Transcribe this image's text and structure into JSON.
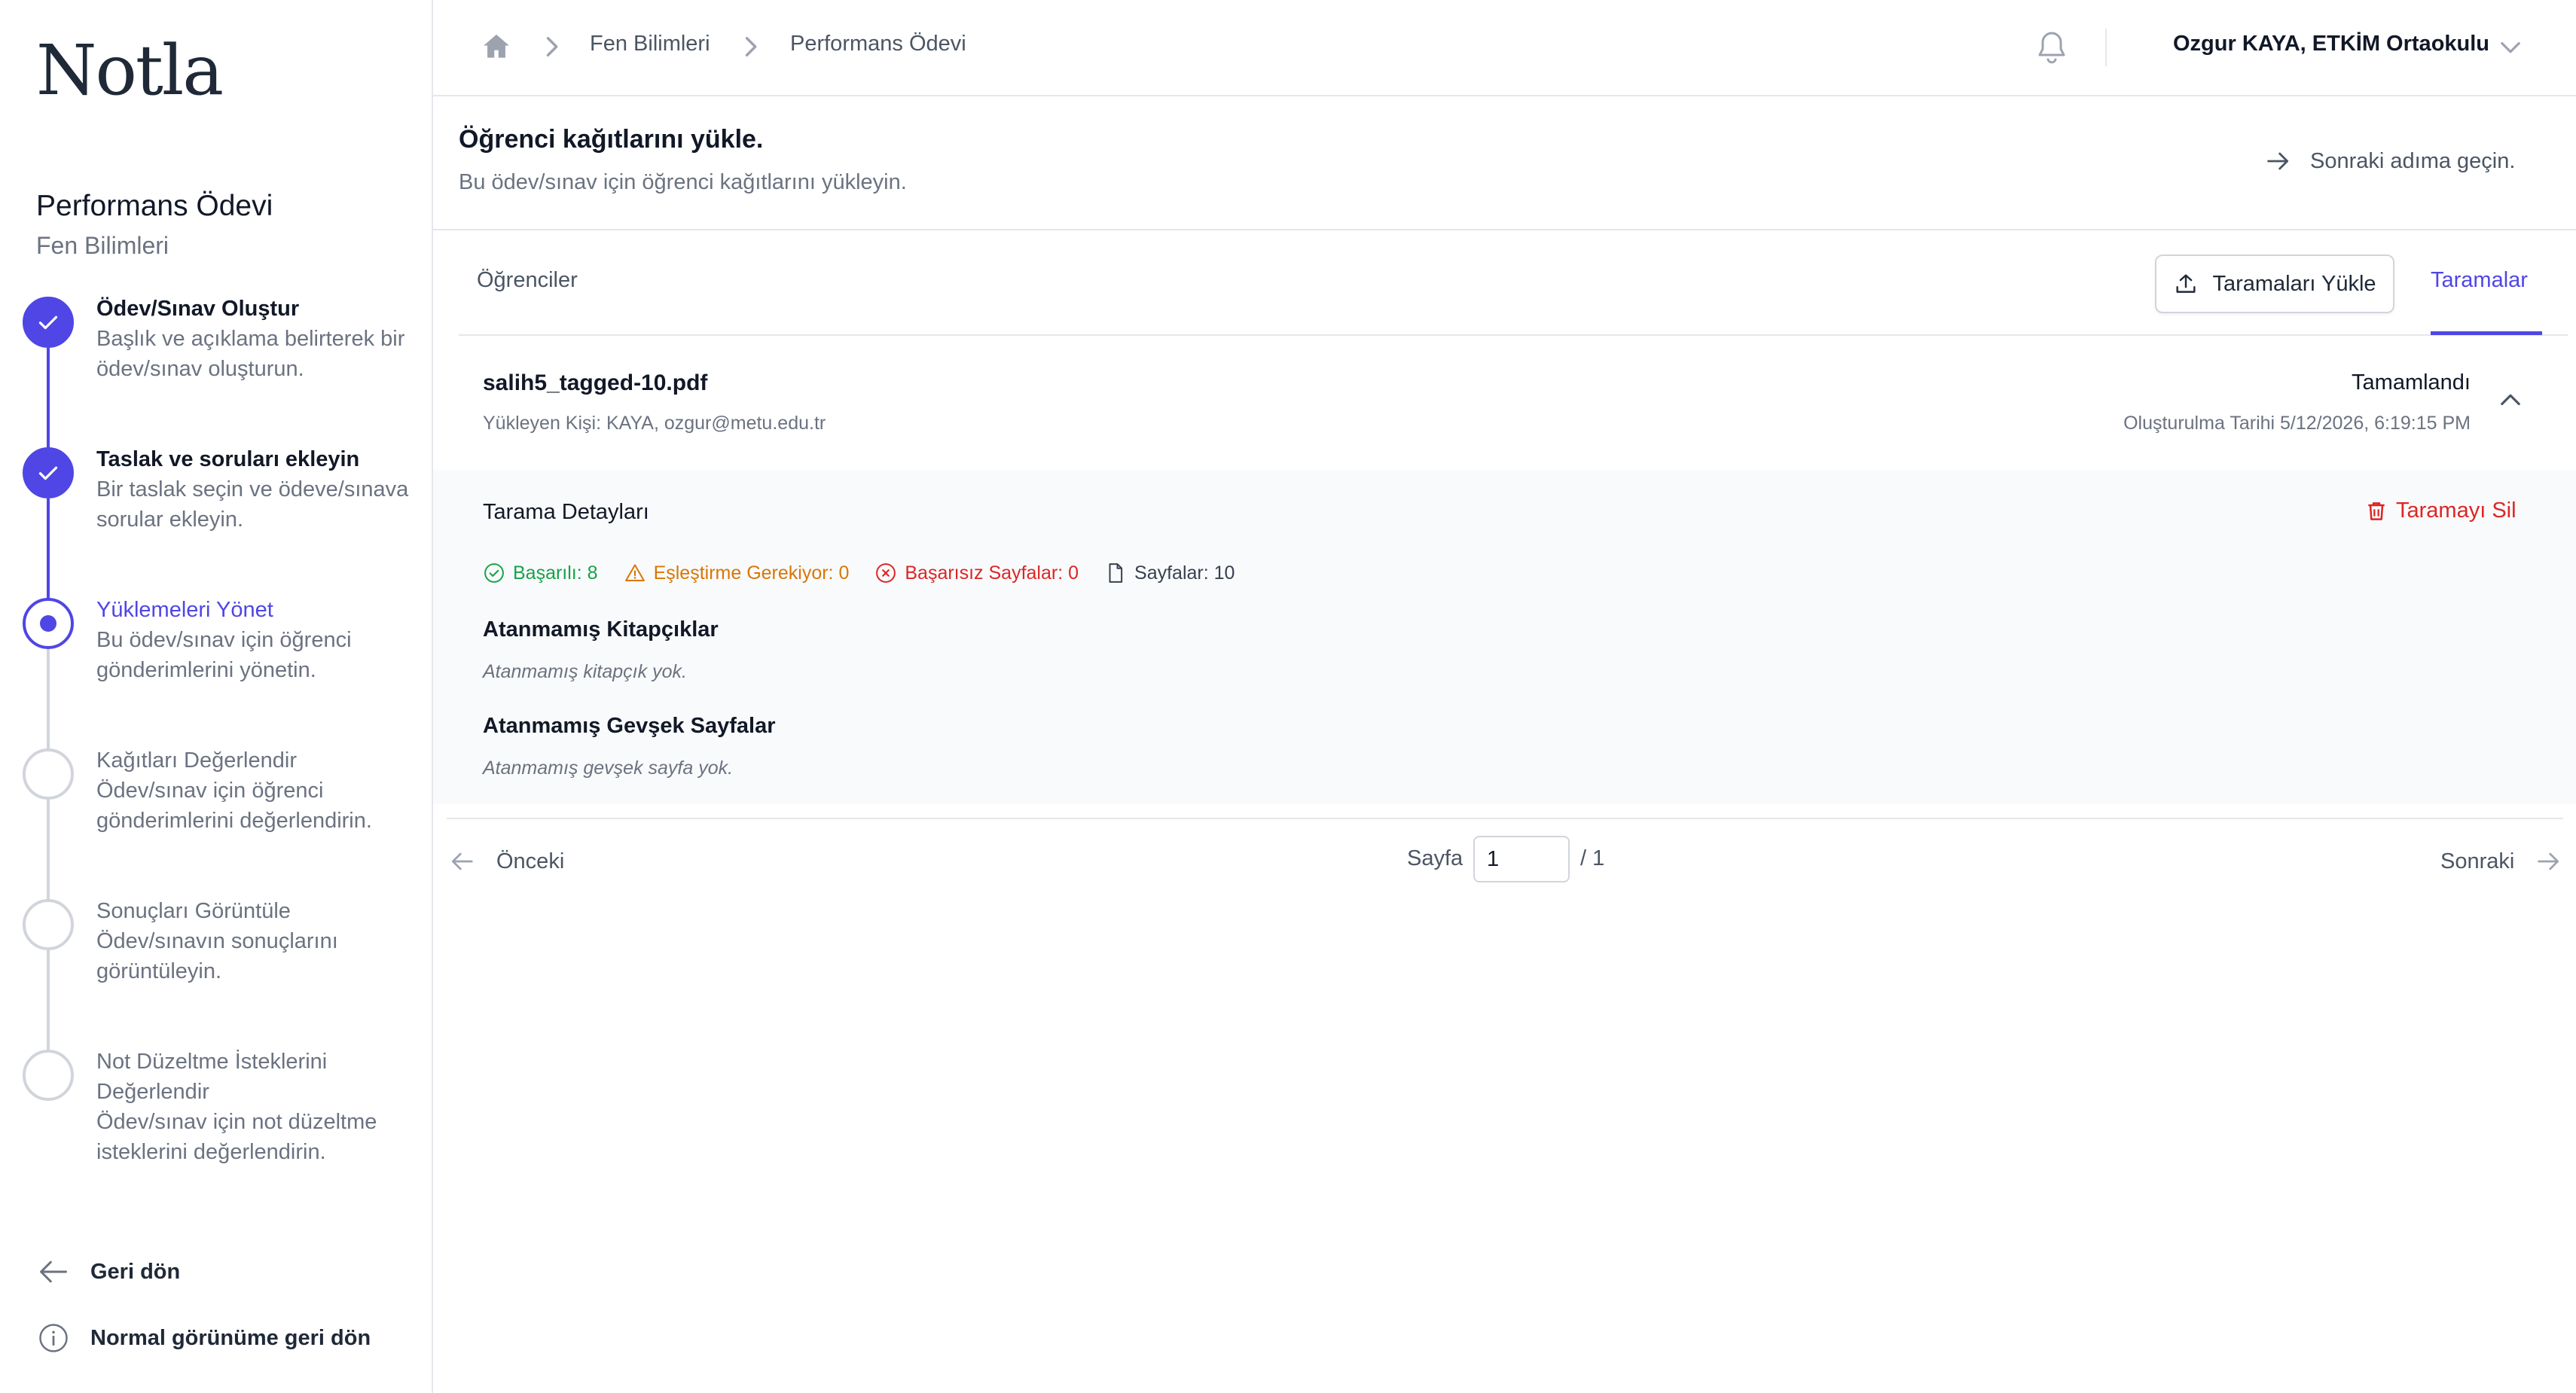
{
  "sidebar": {
    "logo": "Notla",
    "assignment_title": "Performans Ödevi",
    "assignment_subject": "Fen Bilimleri",
    "steps": [
      {
        "title": "Ödev/Sınav Oluştur",
        "desc": "Başlık ve açıklama belirterek bir ödev/sınav oluşturun.",
        "state": "done"
      },
      {
        "title": "Taslak ve soruları ekleyin",
        "desc": "Bir taslak seçin ve ödeve/sınava sorular ekleyin.",
        "state": "done"
      },
      {
        "title": "Yüklemeleri Yönet",
        "desc": "Bu ödev/sınav için öğrenci gönderimlerini yönetin.",
        "state": "current"
      },
      {
        "title": "Kağıtları Değerlendir",
        "desc": "Ödev/sınav için öğrenci gönderimlerini değerlendirin.",
        "state": "todo"
      },
      {
        "title": "Sonuçları Görüntüle",
        "desc": "Ödev/sınavın sonuçlarını görüntüleyin.",
        "state": "todo"
      },
      {
        "title": "Not Düzeltme İsteklerini Değerlendir",
        "desc": "Ödev/sınav için not düzeltme isteklerini değerlendirin.",
        "state": "todo"
      }
    ],
    "back_label": "Geri dön",
    "normal_view_label": "Normal görünüme geri dön"
  },
  "header": {
    "breadcrumbs": [
      "Fen Bilimleri",
      "Performans Ödevi"
    ],
    "user": "Ozgur KAYA, ETKİM Ortaokulu"
  },
  "page": {
    "title": "Öğrenci kağıtlarını yükle.",
    "description": "Bu ödev/sınav için öğrenci kağıtlarını yükleyin.",
    "next_step_label": "Sonraki adıma geçin."
  },
  "tabs": {
    "students": "Öğrenciler",
    "upload_button": "Taramaları Yükle",
    "scans": "Taramalar"
  },
  "scan": {
    "file_name": "salih5_tagged-10.pdf",
    "uploader": "Yükleyen Kişi: KAYA, ozgur@metu.edu.tr",
    "status": "Tamamlandı",
    "created": "Oluşturulma Tarihi 5/12/2026, 6:19:15 PM",
    "details_title": "Tarama Detayları",
    "delete_label": "Taramayı Sil",
    "stats": {
      "success": "Başarılı: 8",
      "needs_match": "Eşleştirme Gerekiyor: 0",
      "failed": "Başarısız Sayfalar: 0",
      "pages": "Sayfalar: 10"
    },
    "unassigned_booklets_title": "Atanmamış Kitapçıklar",
    "unassigned_booklets_empty": "Atanmamış kitapçık yok.",
    "unassigned_pages_title": "Atanmamış Gevşek Sayfalar",
    "unassigned_pages_empty": "Atanmamış gevşek sayfa yok."
  },
  "pagination": {
    "prev_label": "Önceki",
    "page_label": "Sayfa",
    "current_page": "1",
    "total": "/ 1",
    "next_label": "Sonraki"
  },
  "colors": {
    "accent": "#4f46e5",
    "success": "#16a34a",
    "warning": "#d97706",
    "danger": "#dc2626"
  }
}
